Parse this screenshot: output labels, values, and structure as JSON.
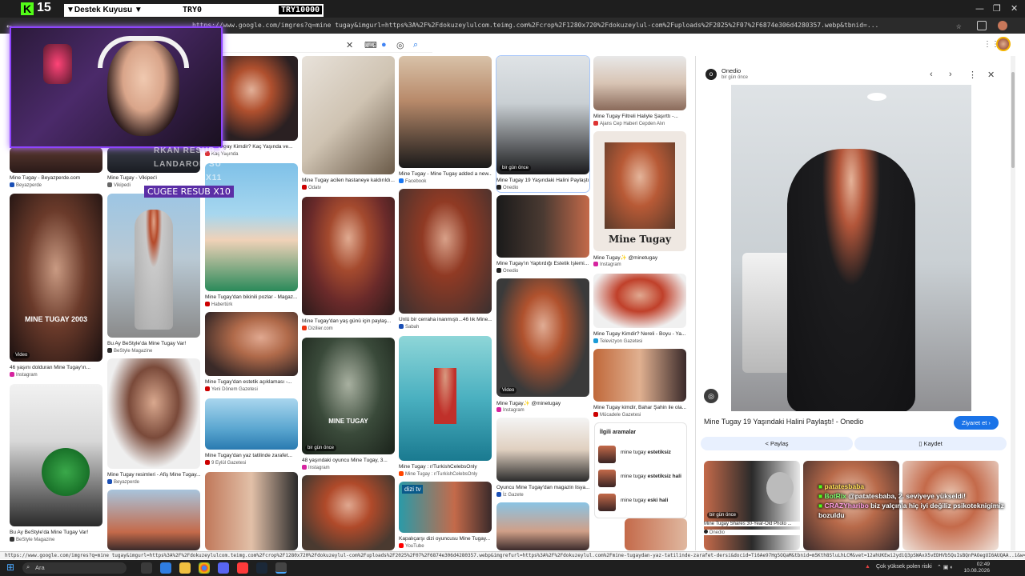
{
  "overlay": {
    "k_logo": "K",
    "k_number": "15",
    "donation_label": "▼Destek Kuyusu ▼",
    "donation_amount": "TRY0",
    "donation_goal": "TRY10000",
    "cugee_text": "CUGEE  RESUB X10",
    "ghost_text_1": "RKAN  RESUB X1",
    "ghost_text_2": "LANDAROH  SU",
    "ghost_text_3": "AM  RESUB X11"
  },
  "browser": {
    "url": "https://www.google.com/imgres?q=mine tugay&imgurl=https%3A%2F%2Fdokuzeylulcom.teimg.com%2Fcrop%2F1280x720%2Fdokuzeylul-com%2Fuploads%2F2025%2F07%2F6874e306d4280357.webp&tbnid=...",
    "status_url": "https://www.google.com/imgres?q=mine tugay&imgurl=https%3A%2F%2Fdokuzeylulcom.teimg.com%2Fcrop%2F1280x720%2Fdokuzeylul-com%2Fuploads%2F2025%2F07%2F6874e306d4280357.webp&imgrefurl=https%3A%2F%2Fdokuzeylul.com%2Fmine-tugaydan-yaz-tatilinde-zarafet-dersi&docid=Ti6Ae97Hg5OQaM&tbnid=m5Kth8SluLhLCM&vet=12ahUKEwi2ydiQ3pSWAxX5vEDHVb5QuIsBQnPAOegUI6AUQAA..i&w=1280&h=720&hcb=2&ved=2ahUKEwi2ydiQ3pSW"
  },
  "icons": {
    "minimize": "—",
    "maximize": "❐",
    "close": "✕",
    "back": "←",
    "star": "☆",
    "clear": "✕",
    "keyboard": "⌨",
    "mic": "●",
    "lens": "◎",
    "search": "⌕",
    "apps": "⋮⋮",
    "windows": "⊞",
    "prev": "‹",
    "next": "›",
    "more": "⋮",
    "share": "<",
    "save": "▯",
    "visit_arrow": "›"
  },
  "grid": [
    {
      "cap": "Mine Tugay - Beyazperde.com",
      "src": "Beyazperde",
      "color": "#1a4fb5"
    },
    {
      "cap": "Mine Tugay - Vikipedi",
      "src": "Vikipedi",
      "color": "#666"
    },
    {
      "cap": "Mine Tugay Kimdir? Kaç Yaşında ve...",
      "src": "Kaç Yaşında",
      "color": "#d33"
    },
    {
      "cap": "Mine Tugay acilen hastaneye kaldırıldı...",
      "src": "Odatv",
      "color": "#c00"
    },
    {
      "cap": "Mine Tugay - Mine Tugay added a new...",
      "src": "Facebook",
      "color": "#1877f2"
    },
    {
      "cap": "Mine Tugay 19 Yaşındaki Halini Paylaştı...",
      "src": "Onedio",
      "color": "#222",
      "badge": "bir gün önce"
    },
    {
      "cap": "Mine Tugay Filtreli Haliyle Şaşırttı -...",
      "src": "Ajans Cep Haberi Cepden Alın",
      "color": "#d33"
    },
    {
      "cap": "46 yaşını dolduran Mine Tugay'ın...",
      "src": "Instagram",
      "color": "#d6249f",
      "badge": "Video",
      "overlay": "MINE TUGAY 2003"
    },
    {
      "cap": "Bu Ay BeStyle'da Mine Tugay Var!",
      "src": "BeStyle Magazine",
      "color": "#333"
    },
    {
      "cap": "Mine Tugay'dan bikinili pozlar - Magaz...",
      "src": "Habertürk",
      "color": "#c00"
    },
    {
      "cap": "Mine Tugay'dan yaş günü için paylaş...",
      "src": "Dizilier.com",
      "color": "#e31"
    },
    {
      "cap": "Ünlü bir cerraha inanmıştı...46 lık Mine...",
      "src": "Sabah",
      "color": "#1a4fb5"
    },
    {
      "cap": "Mine Tugay'ın Yaptırdığı Estetik İşlemi...",
      "src": "Onedio",
      "color": "#222"
    },
    {
      "cap": "Mine Tugay✨ @minetugay",
      "src": "Instagram",
      "color": "#d6249f",
      "overlay": "Mine Tugay"
    },
    {
      "cap": "Mine Tugay Kimdir? Nereli - Boyu - Ya...",
      "src": "Televizyon Gazetesi",
      "color": "#1a9bd7"
    },
    {
      "cap": "Mine Tugay'dan estetik açıklaması -...",
      "src": "Yeni Dönem Gazetesi",
      "color": "#c00"
    },
    {
      "cap": "Mine Tugay'dan yaz tatilinde zarafet...",
      "src": "9 Eylül Gazetesi",
      "color": "#c00"
    },
    {
      "cap": "48 yaşındaki oyuncu Mine Tugay, 3...",
      "src": "Instagram",
      "color": "#d6249f",
      "badge": "bir gün önce",
      "overlay": "MINE TUGAY"
    },
    {
      "cap": "Mine Tugay : r/TurkishCelebsOnly",
      "src": "Mine Tugay : r/TurkishCelebsOnly",
      "color": "#ff4500"
    },
    {
      "cap": "Mine Tugay✨ @minetugay",
      "src": "Instagram",
      "color": "#d6249f",
      "badge": "Video"
    },
    {
      "cap": "Mine Tugay kimdir, Bahar Şahin ile ola...",
      "src": "Mücadele Gazetesi",
      "color": "#c00"
    },
    {
      "cap": "Mine Tugay resimleri - Afiş Mine Tugay...",
      "src": "Beyazperde",
      "color": "#1a4fb5"
    },
    {
      "cap": "Bu Ay BeStyle'da Mine Tugay Var!",
      "src": "BeStyle Magazine",
      "color": "#333"
    },
    {
      "cap": "Oyuncu Mine Tugay'dan magazin lisya...",
      "src": "İz Gazete",
      "color": "#1a4fb5"
    },
    {
      "cap": "Kapalıçarşı dizi oyuncusu Mine Tugay...",
      "src": "YouTube",
      "color": "#f00",
      "overlay": "dizi tv"
    }
  ],
  "related": {
    "heading": "İlgili aramalar",
    "items": [
      {
        "pre": "mine tugay ",
        "bold": "estetiksiz"
      },
      {
        "pre": "mine tugay ",
        "bold": "estetiksiz hali"
      },
      {
        "pre": "mine tugay ",
        "bold": "eski hali"
      }
    ]
  },
  "panel": {
    "site": "Onedio",
    "time": "bir gün önce",
    "title": "Mine Tugay 19 Yaşındaki Halini Paylaştı! - Onedio",
    "visit": "Ziyaret et",
    "share": "Paylaş",
    "save": "Kaydet",
    "related_caps": [
      {
        "badge": "bir gün önce",
        "cap": "Mine Tugay Shares 30-Year-Old Photo ...",
        "src": "Onedio"
      }
    ]
  },
  "chat": {
    "line1_user": "patatesbaba",
    "line2_user": "BotRix",
    "line2_text": "@patatesbaba, 2. seviyeye yükseldi!",
    "line3_user": "CRAZYharibo",
    "line3_text": "biz yalçınla hiç iyi değiliz psikoteknigimiz bozuldu"
  },
  "taskbar": {
    "search_placeholder": "Ara",
    "weather": "Çok yüksek polen riski",
    "time": "02:49",
    "date": "10.08.2026"
  }
}
